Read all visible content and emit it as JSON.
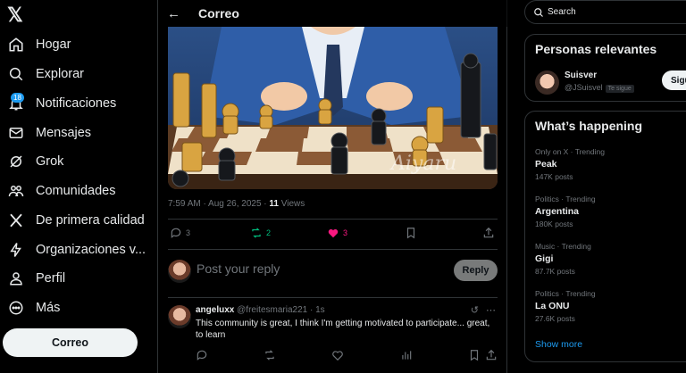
{
  "brand": {
    "logo": "𝕏"
  },
  "nav": {
    "items": [
      {
        "label": "Hogar",
        "icon": "home-icon"
      },
      {
        "label": "Explorar",
        "icon": "search-icon"
      },
      {
        "label": "Notificaciones",
        "icon": "bell-icon"
      },
      {
        "label": "Mensajes",
        "icon": "mail-icon"
      },
      {
        "label": "Grok",
        "icon": "grok-icon"
      },
      {
        "label": "Comunidades",
        "icon": "people-icon"
      },
      {
        "label": "De primera calidad",
        "icon": "x-premium-icon"
      },
      {
        "label": "Organizaciones v...",
        "icon": "lightning-icon"
      },
      {
        "label": "Perfil",
        "icon": "person-icon"
      },
      {
        "label": "Más",
        "icon": "more-circle-icon"
      }
    ],
    "notifications_badge": "18",
    "compose_label": "Correo"
  },
  "post": {
    "header_title": "Correo",
    "timestamp": "7:59 AM · Aug 26, 2025 ·",
    "views_count": "11",
    "views_label": "Views",
    "watermark": "Aiyaru",
    "actions": {
      "replies": "3",
      "reposts": "2",
      "likes": "3"
    },
    "reply_placeholder": "Post your reply",
    "reply_button": "Reply",
    "colors": {
      "repost": "#00ba7c",
      "like": "#f91880",
      "accent": "#1d9bf0"
    }
  },
  "comment": {
    "name": "angeluxx",
    "handle": "@freitesmaria221",
    "time": "· 1s",
    "text": "This community is great, I think I'm getting motivated to participate... great, to learn"
  },
  "sidebar_right": {
    "search_placeholder": "Search",
    "relevant_title": "Personas relevantes",
    "person": {
      "name": "Suisver",
      "handle": "@JSuisvel",
      "tag": "Te sigue",
      "follow_label": "Sigu"
    },
    "happening_title": "What’s happening",
    "trends": [
      {
        "context": "Only on X · Trending",
        "name": "Peak",
        "posts": "147K posts"
      },
      {
        "context": "Politics · Trending",
        "name": "Argentina",
        "posts": "180K posts"
      },
      {
        "context": "Music · Trending",
        "name": "Gigi",
        "posts": "87.7K posts"
      },
      {
        "context": "Politics · Trending",
        "name": "La ONU",
        "posts": "27.6K posts"
      }
    ],
    "show_more": "Show more"
  }
}
